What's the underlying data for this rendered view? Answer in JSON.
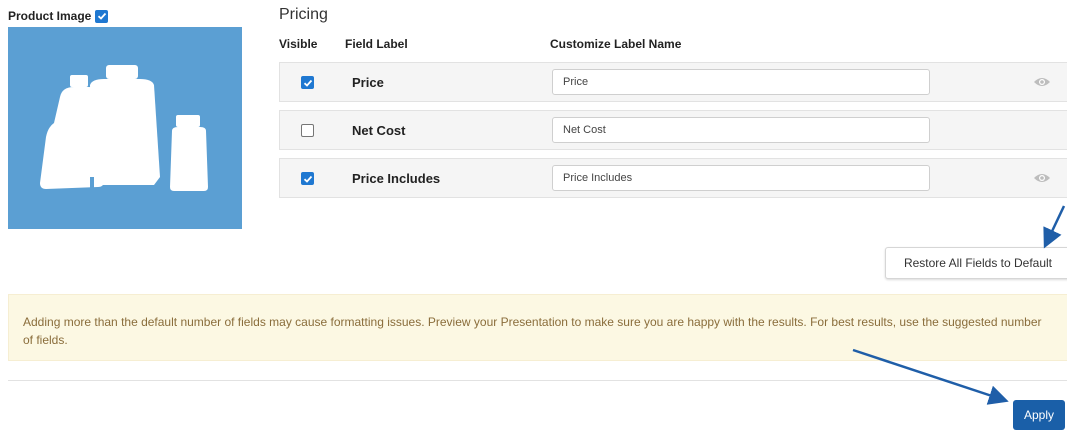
{
  "product_image": {
    "label": "Product Image",
    "checked": true
  },
  "pricing": {
    "title": "Pricing",
    "columns": {
      "visible": "Visible",
      "field_label": "Field Label",
      "custom_label": "Customize Label Name"
    },
    "rows": [
      {
        "label": "Price",
        "value": "Price",
        "visible": true,
        "eye": "eye-icon"
      },
      {
        "label": "Net Cost",
        "value": "Net Cost",
        "visible": false
      },
      {
        "label": "Price Includes",
        "value": "Price Includes",
        "visible": true,
        "eye": "eye-icon"
      }
    ]
  },
  "restore_button": "Restore All Fields to Default",
  "warning": "Adding more than the default number of fields may cause formatting issues. Preview your Presentation to make sure you are happy with the results. For best results, use the suggested number of fields.",
  "apply_button": "Apply",
  "colors": {
    "accent": "#1f78d1",
    "apply": "#1a5fa8",
    "image_bg": "#5b9fd3",
    "warning_bg": "#fcf8e3",
    "warning_text": "#8a6d3b",
    "annotation_arrow": "#1f5ea8"
  }
}
